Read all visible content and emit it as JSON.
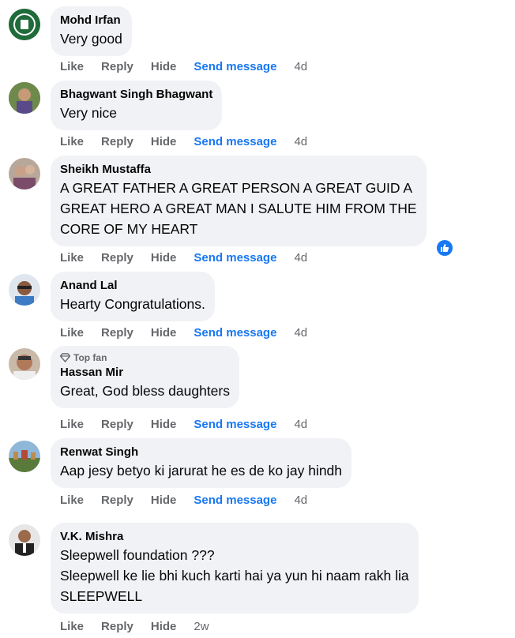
{
  "actions": {
    "like": "Like",
    "reply": "Reply",
    "hide": "Hide",
    "send": "Send message"
  },
  "colors": {
    "bubble": "#f0f2f5",
    "link": "#1877f2",
    "muted": "#65676b",
    "text": "#050505"
  },
  "comments": [
    {
      "author": "Mohd Irfan",
      "lines": [
        "Very good"
      ],
      "time": "4d",
      "send": true
    },
    {
      "author": "Bhagwant Singh Bhagwant",
      "lines": [
        "Very nice"
      ],
      "time": "4d",
      "send": true
    },
    {
      "author": "Sheikh Mustaffa",
      "lines": [
        "A GREAT FATHER A GREAT PERSON A GREAT GUID A",
        "GREAT HERO A GREAT MAN I SALUTE HIM FROM THE",
        "CORE OF MY HEART"
      ],
      "time": "4d",
      "send": true,
      "reaction": "like-icon"
    },
    {
      "author": "Anand Lal",
      "lines": [
        "Hearty Congratulations."
      ],
      "time": "4d",
      "send": true
    },
    {
      "badge": "Top fan",
      "author": "Hassan Mir",
      "lines": [
        "Great, God bless daughters"
      ],
      "time": "4d",
      "send": true
    },
    {
      "author": "Renwat Singh",
      "lines": [
        "Aap jesy betyo ki jarurat he es de ko jay hindh"
      ],
      "time": "4d",
      "send": true
    },
    {
      "author": "V.K. Mishra",
      "lines": [
        "Sleepwell foundation ???",
        "Sleepwell ke lie bhi kuch karti hai ya yun hi naam rakh lia",
        "SLEEPWELL"
      ],
      "time": "2w",
      "send": false
    }
  ]
}
